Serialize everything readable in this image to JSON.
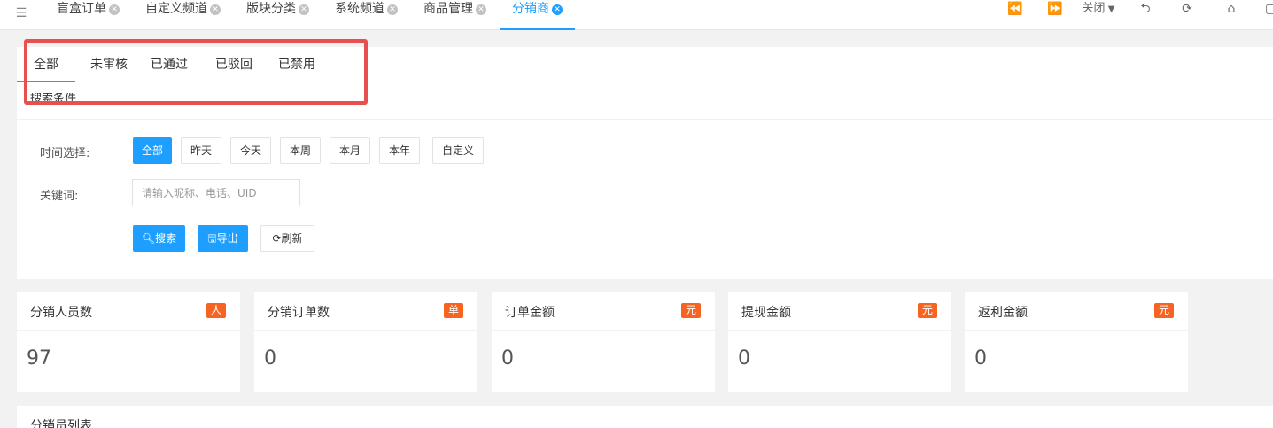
{
  "topbar": {
    "tabs": [
      {
        "label": "盲盒订单"
      },
      {
        "label": "自定义频道"
      },
      {
        "label": "版块分类"
      },
      {
        "label": "系统频道"
      },
      {
        "label": "商品管理"
      },
      {
        "label": "分销商"
      }
    ],
    "active_tab": "分销商",
    "close_label": "关闭",
    "icons": [
      "menu-toggle-icon",
      "prev-icon",
      "next-icon",
      "close-dropdown-icon",
      "back-icon",
      "refresh-icon",
      "home-icon",
      "fullscreen-icon"
    ]
  },
  "subtabs": [
    "全部",
    "未审核",
    "已通过",
    "已驳回",
    "已禁用"
  ],
  "search": {
    "title": "搜索条件",
    "time_label": "时间选择:",
    "time_options": [
      "全部",
      "昨天",
      "今天",
      "本周",
      "本月",
      "本年",
      "自定义"
    ],
    "keyword_label": "关键词:",
    "keyword_placeholder": "请输入昵称、电话、UID",
    "search_btn": "搜索",
    "export_btn": "导出",
    "refresh_btn": "刷新"
  },
  "stats": [
    {
      "title": "分销人员数",
      "badge": "人",
      "value": "97"
    },
    {
      "title": "分销订单数",
      "badge": "单",
      "value": "0"
    },
    {
      "title": "订单金额",
      "badge": "元",
      "value": "0"
    },
    {
      "title": "提现金额",
      "badge": "元",
      "value": "0"
    },
    {
      "title": "返利金额",
      "badge": "元",
      "value": "0"
    }
  ],
  "list": {
    "title": "分销员列表"
  },
  "colors": {
    "accent": "#1e9fff",
    "badge": "#f76422",
    "highlight": "#e84f4f"
  }
}
